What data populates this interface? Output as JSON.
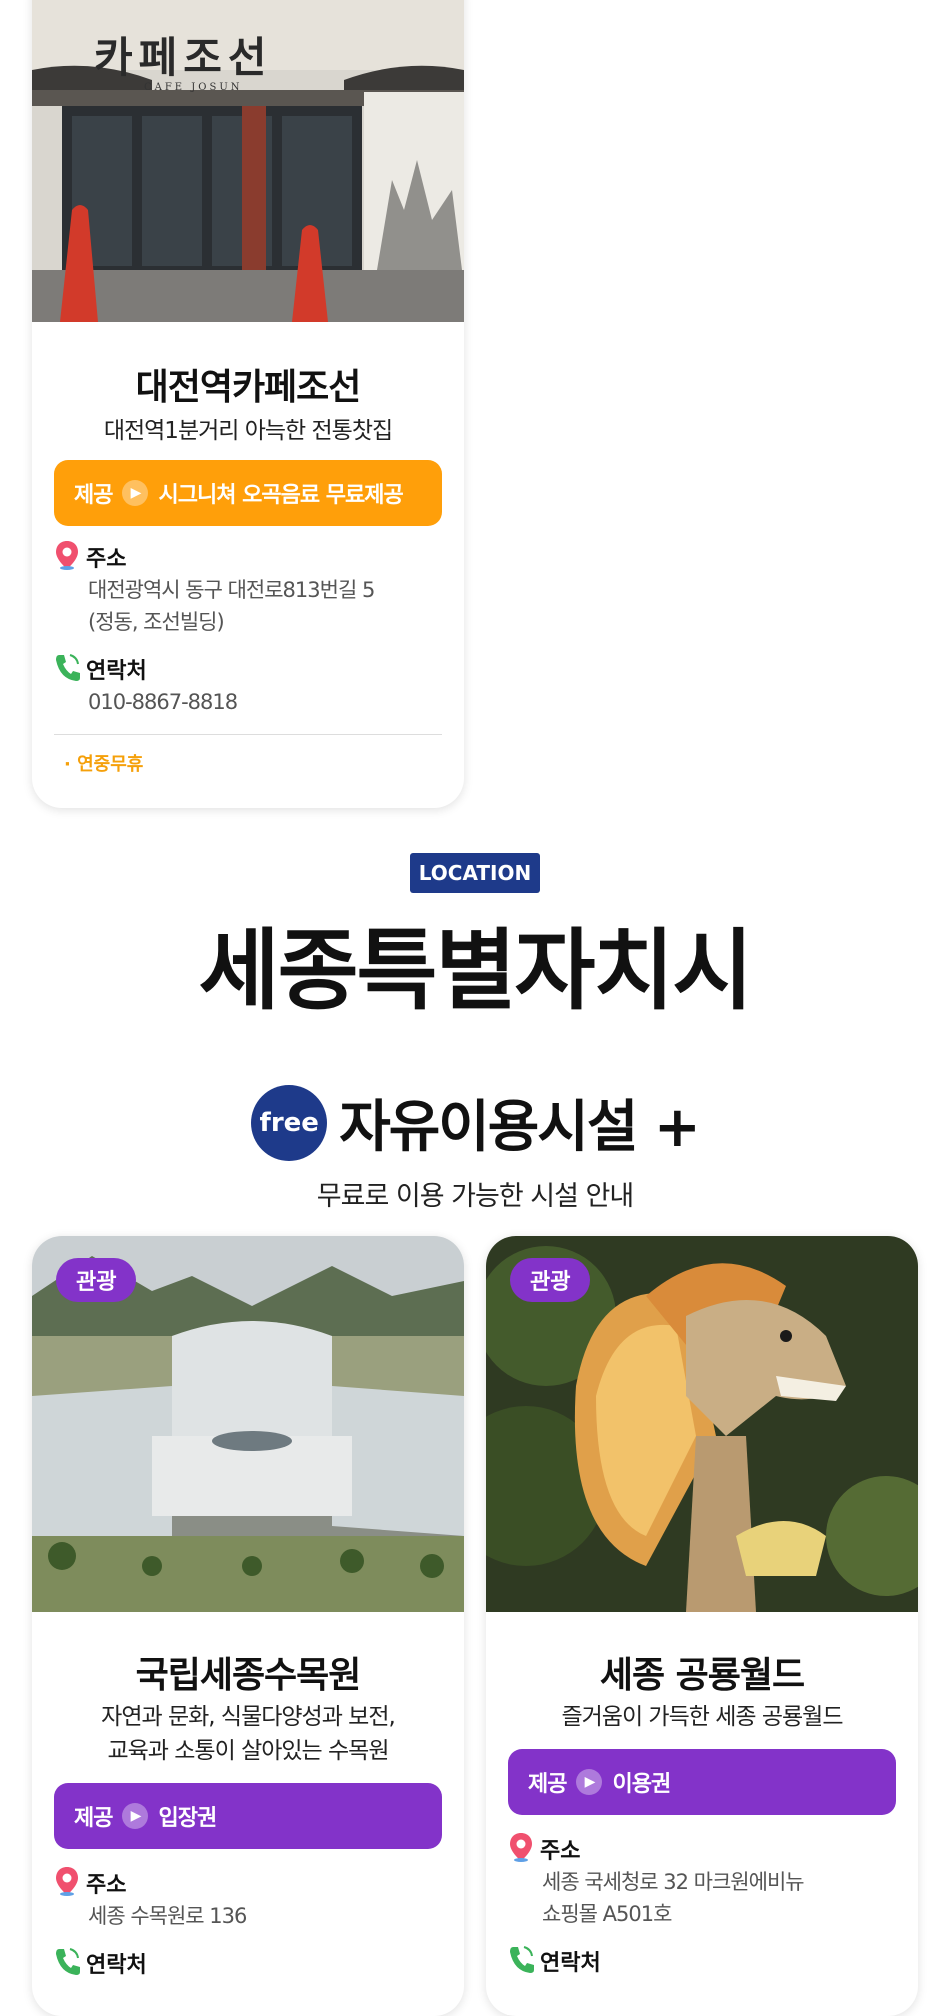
{
  "colors": {
    "orange": "#ff9f0a",
    "purple": "#8333c9",
    "navy": "#1e3a8a",
    "note": "#f5a00a"
  },
  "cafe_card": {
    "sign_text": "카페조선",
    "sign_sub": "CAFE JOSUN",
    "title": "대전역카페조선",
    "desc": "대전역1분거리 아늑한 전통찻집",
    "benefit_label": "제공",
    "benefit_text": "시그니쳐 오곡음료 무료제공",
    "address_label": "주소",
    "address_line1": "대전광역시 동구 대전로813번길 5",
    "address_line2": "(정동, 조선빌딩)",
    "contact_label": "연락처",
    "contact_value": "010-8867-8818",
    "note": "· 연중무휴"
  },
  "section": {
    "badge": "LOCATION",
    "title": "세종특별자치시",
    "free_badge": "free",
    "subtitle": "자유이용시설 +",
    "caption": "무료로 이용 가능한 시설 안내"
  },
  "cards": [
    {
      "tag": "관광",
      "title": "국립세종수목원",
      "desc_line1": "자연과 문화, 식물다양성과 보전,",
      "desc_line2": "교육과 소통이 살아있는 수목원",
      "benefit_label": "제공",
      "benefit_text": "입장권",
      "address_label": "주소",
      "address_line1": "세종 수목원로 136",
      "contact_label": "연락처"
    },
    {
      "tag": "관광",
      "title": "세종 공룡월드",
      "desc_line1": "즐거움이 가득한 세종 공룡월드",
      "benefit_label": "제공",
      "benefit_text": "이용권",
      "address_label": "주소",
      "address_line1": "세종 국세청로 32 마크원에비뉴",
      "address_line2": "쇼핑몰 A501호",
      "contact_label": "연락처"
    }
  ]
}
